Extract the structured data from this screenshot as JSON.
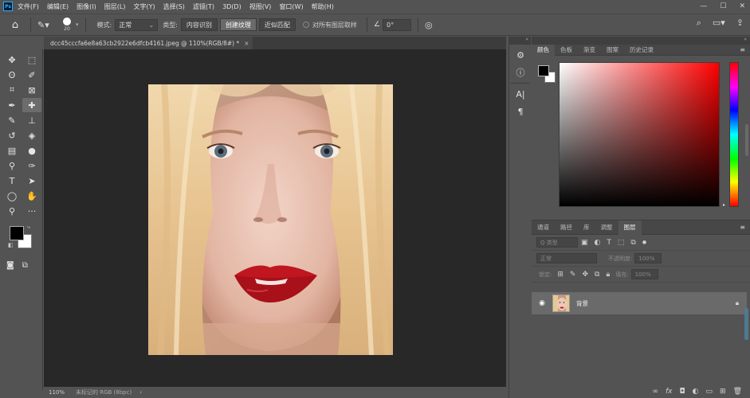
{
  "app": {
    "logo": "Ps",
    "menu": [
      "文件(F)",
      "编辑(E)",
      "图像(I)",
      "图层(L)",
      "文字(Y)",
      "选择(S)",
      "滤镜(T)",
      "3D(D)",
      "视图(V)",
      "窗口(W)",
      "帮助(H)"
    ],
    "window_controls": [
      "minimize-icon",
      "maximize-icon",
      "close-icon"
    ]
  },
  "options": {
    "brush_size": "20",
    "mode_label": "模式:",
    "mode_value": "正常",
    "type_label": "类型:",
    "type_buttons": [
      "内容识别",
      "创建纹理",
      "近似匹配"
    ],
    "active_type": "创建纹理",
    "sample_all_label": "对所有图层取样",
    "angle_value": "0°",
    "right_icons": [
      "search-icon",
      "workspace-icon",
      "share-icon"
    ]
  },
  "document": {
    "tab_title": "dcc45cccfa6e8a63cb2922e6dfcb4161.jpeg @ 110%(RGB/8#) *",
    "close": "×"
  },
  "status": {
    "zoom": "110%",
    "info": "未标记的 RGB (8bpc)",
    "arrow": "›"
  },
  "color_panel": {
    "tabs": [
      "颜色",
      "色板",
      "渐变",
      "图案",
      "历史记录"
    ],
    "active_tab": "颜色",
    "foreground": "#000000",
    "background": "#ffffff",
    "hue": "#ff0000"
  },
  "layers_panel": {
    "tabs": [
      "通道",
      "路径",
      "库",
      "调整",
      "图层"
    ],
    "active_tab": "图层",
    "filter_placeholder": "Q 类型",
    "blend_mode": "正常",
    "opacity_label": "不透明度:",
    "opacity_value": "100%",
    "lock_label": "锁定:",
    "fill_label": "填充:",
    "fill_value": "100%",
    "layers": [
      {
        "name": "背景",
        "visible": true,
        "locked": true
      }
    ],
    "bottom_icons": [
      "link-icon",
      "fx-icon",
      "mask-icon",
      "adjustment-icon",
      "group-icon",
      "new-layer-icon",
      "delete-icon"
    ],
    "fx_label": "fx"
  }
}
